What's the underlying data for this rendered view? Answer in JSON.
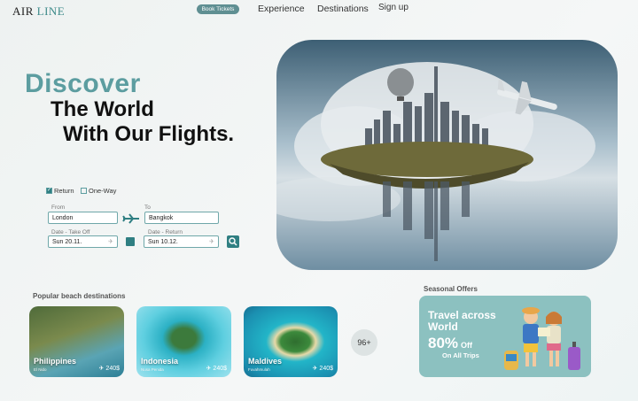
{
  "brand": {
    "part1": "AIR",
    "part2": "LINE"
  },
  "nav": {
    "book_label": "Book Tickets",
    "experience": "Experience",
    "destinations": "Destinations",
    "signup": "Sign up"
  },
  "hero": {
    "line1": "Discover",
    "line2": "The World",
    "line3": "With Our Flights."
  },
  "booking": {
    "return_label": "Return",
    "oneway_label": "One-Way",
    "trip_type": "Return",
    "from_label": "From",
    "to_label": "To",
    "from_value": "London",
    "to_value": "Bangkok",
    "takeoff_label": "Date - Take Off",
    "return_date_label": "Date - Return",
    "takeoff_value": "Sun 20.11.",
    "return_value": "Sun 10.12."
  },
  "popular": {
    "title": "Popular beach destinations",
    "cards": [
      {
        "name": "Philippines",
        "sub": "El Nido",
        "price": "240$"
      },
      {
        "name": "Indonesia",
        "sub": "Nusa Penida",
        "price": "240$"
      },
      {
        "name": "Maldives",
        "sub": "Fuvahmulah",
        "price": "240$"
      }
    ],
    "more": "96+"
  },
  "offers": {
    "title": "Seasonal Offers",
    "line1": "Travel across",
    "line2": "World",
    "percent": "80%",
    "off": "Off",
    "trips": "On All Trips"
  },
  "colors": {
    "accent": "#5c9da0",
    "dark_accent": "#2f7f82",
    "offer_bg": "#8cc1c0"
  }
}
